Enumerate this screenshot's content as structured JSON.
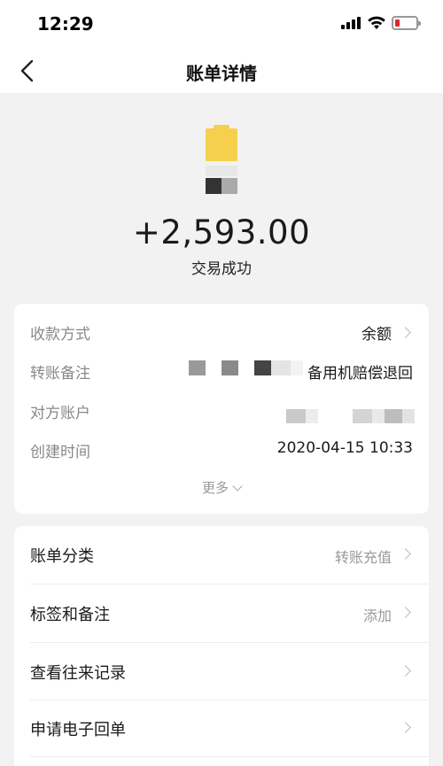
{
  "status_bar": {
    "time": "12:29"
  },
  "nav": {
    "title": "账单详情"
  },
  "transaction": {
    "amount": "+2,593.00",
    "status": "交易成功"
  },
  "details": {
    "payment_method_label": "收款方式",
    "payment_method_value": "余额",
    "note_label": "转账备注",
    "note_value_visible": "备用机赔偿退回",
    "counterparty_label": "对方账户",
    "created_time_label": "创建时间",
    "created_time_value": "2020-04-15 10:33",
    "more_label": "更多"
  },
  "actions": {
    "category_label": "账单分类",
    "category_value": "转账充值",
    "tags_label": "标签和备注",
    "tags_value": "添加",
    "history_label": "查看往来记录",
    "receipt_label": "申请电子回单"
  },
  "colors": {
    "background": "#f2f2f2",
    "card": "#ffffff",
    "label_grey": "#888888",
    "avatar_yellow": "#f6d04d",
    "battery_red": "#e0262d"
  },
  "icons": [
    "back-chevron-icon",
    "chevron-right-icon",
    "chevron-down-icon",
    "signal-icon",
    "wifi-icon",
    "battery-icon"
  ]
}
